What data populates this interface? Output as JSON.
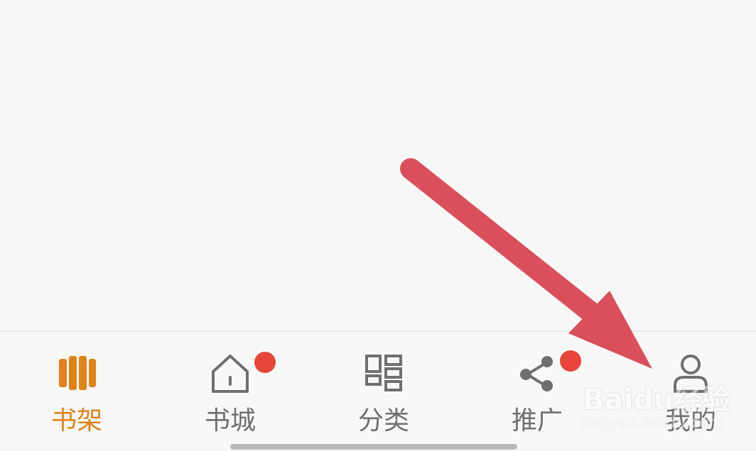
{
  "tabbar": {
    "tabs": [
      {
        "label": "书架",
        "icon": "bookshelf-icon",
        "active": true,
        "badge": false
      },
      {
        "label": "书城",
        "icon": "house-icon",
        "active": false,
        "badge": true
      },
      {
        "label": "分类",
        "icon": "category-grid-icon",
        "active": false,
        "badge": false
      },
      {
        "label": "推广",
        "icon": "share-icon",
        "active": false,
        "badge": true
      },
      {
        "label": "我的",
        "icon": "person-icon",
        "active": false,
        "badge": false
      }
    ]
  },
  "colors": {
    "active": "#e0821a",
    "inactive": "#6f6f6f",
    "badge": "#e8453c",
    "arrow": "#d9505c"
  },
  "watermark": {
    "brand": "Baidu经验",
    "url": "jingyan.baidu.com"
  }
}
